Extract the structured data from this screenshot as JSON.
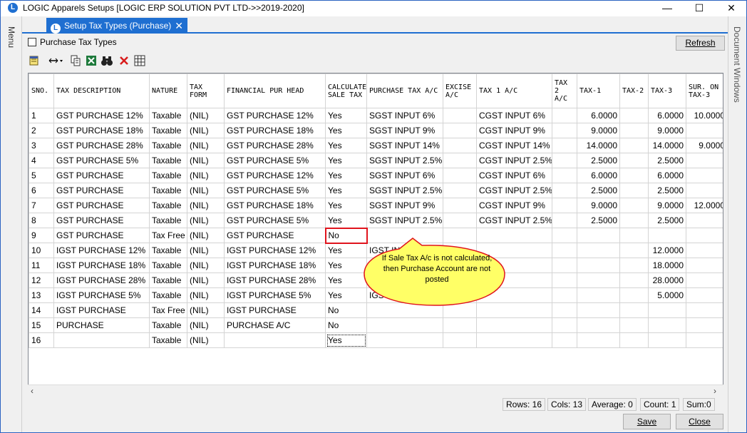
{
  "window": {
    "title": "LOGIC Apparels Setups  [LOGIC ERP SOLUTION PVT LTD->>2019-2020]",
    "minimize": "—",
    "maximize": "☐",
    "close": "✕"
  },
  "sidebars": {
    "left": "Menu",
    "right": "Document Windows"
  },
  "tab": {
    "label": "Setup Tax Types (Purchase)",
    "close": "✕"
  },
  "filter": {
    "checkbox_label": "Purchase Tax Types",
    "checked": false
  },
  "refresh_label": "Refresh",
  "toolbar": {
    "icons": [
      "notepad-icon",
      "resize-columns-icon",
      "copy-icon",
      "excel-icon",
      "binoculars-icon",
      "delete-icon",
      "grid-icon"
    ]
  },
  "columns": [
    "SNO.",
    "TAX DESCRIPTION",
    "NATURE",
    "TAX FORM",
    "FINANCIAL PUR HEAD",
    "CALCULATE SALE TAX",
    "PURCHASE TAX A/C",
    "EXCISE A/C",
    "TAX 1 A/C",
    "TAX 2 A/C",
    "TAX-1",
    "TAX-2",
    "TAX-3",
    "SUR. ON TAX-3"
  ],
  "rows": [
    {
      "sno": "1",
      "desc": "GST PURCHASE 12%",
      "nature": "Taxable",
      "form": "(NIL)",
      "head": "GST PURCHASE 12%",
      "calc": "Yes",
      "ptax": "SGST INPUT 6%",
      "excise": "",
      "tax1ac": "CGST INPUT 6%",
      "tax2ac": "",
      "tax1": "6.0000",
      "tax2": "",
      "tax3": "6.0000",
      "sur": "10.0000"
    },
    {
      "sno": "2",
      "desc": "GST PURCHASE 18%",
      "nature": "Taxable",
      "form": "(NIL)",
      "head": "GST PURCHASE 18%",
      "calc": "Yes",
      "ptax": "SGST INPUT 9%",
      "excise": "",
      "tax1ac": "CGST INPUT 9%",
      "tax2ac": "",
      "tax1": "9.0000",
      "tax2": "",
      "tax3": "9.0000",
      "sur": ""
    },
    {
      "sno": "3",
      "desc": "GST PURCHASE 28%",
      "nature": "Taxable",
      "form": "(NIL)",
      "head": "GST PURCHASE 28%",
      "calc": "Yes",
      "ptax": "SGST INPUT 14%",
      "excise": "",
      "tax1ac": "CGST INPUT 14%",
      "tax2ac": "",
      "tax1": "14.0000",
      "tax2": "",
      "tax3": "14.0000",
      "sur": "9.0000"
    },
    {
      "sno": "4",
      "desc": "GST PURCHASE 5%",
      "nature": "Taxable",
      "form": "(NIL)",
      "head": "GST PURCHASE 5%",
      "calc": "Yes",
      "ptax": "SGST INPUT 2.5%",
      "excise": "",
      "tax1ac": "CGST INPUT 2.5%",
      "tax2ac": "",
      "tax1": "2.5000",
      "tax2": "",
      "tax3": "2.5000",
      "sur": ""
    },
    {
      "sno": "5",
      "desc": "GST PURCHASE",
      "nature": "Taxable",
      "form": "(NIL)",
      "head": "GST PURCHASE 12%",
      "calc": "Yes",
      "ptax": "SGST  INPUT 6%",
      "excise": "",
      "tax1ac": "CGST INPUT 6%",
      "tax2ac": "",
      "tax1": "6.0000",
      "tax2": "",
      "tax3": "6.0000",
      "sur": ""
    },
    {
      "sno": "6",
      "desc": "GST PURCHASE",
      "nature": "Taxable",
      "form": "(NIL)",
      "head": "GST PURCHASE 5%",
      "calc": "Yes",
      "ptax": "SGST INPUT 2.5%",
      "excise": "",
      "tax1ac": "CGST INPUT 2.5%",
      "tax2ac": "",
      "tax1": "2.5000",
      "tax2": "",
      "tax3": "2.5000",
      "sur": ""
    },
    {
      "sno": "7",
      "desc": "GST PURCHASE",
      "nature": "Taxable",
      "form": "(NIL)",
      "head": "GST PURCHASE 18%",
      "calc": "Yes",
      "ptax": "SGST INPUT 9%",
      "excise": "",
      "tax1ac": "CGST INPUT 9%",
      "tax2ac": "",
      "tax1": "9.0000",
      "tax2": "",
      "tax3": "9.0000",
      "sur": "12.0000"
    },
    {
      "sno": "8",
      "desc": "GST PURCHASE",
      "nature": "Taxable",
      "form": "(NIL)",
      "head": "GST PURCHASE 5%",
      "calc": "Yes",
      "ptax": "SGST INPUT 2.5%",
      "excise": "",
      "tax1ac": "CGST INPUT 2.5%",
      "tax2ac": "",
      "tax1": "2.5000",
      "tax2": "",
      "tax3": "2.5000",
      "sur": ""
    },
    {
      "sno": "9",
      "desc": "GST PURCHASE",
      "nature": "Tax Free",
      "form": "(NIL)",
      "head": "GST PURCHASE",
      "calc": "No",
      "ptax": "",
      "excise": "",
      "tax1ac": "",
      "tax2ac": "",
      "tax1": "",
      "tax2": "",
      "tax3": "",
      "sur": ""
    },
    {
      "sno": "10",
      "desc": "IGST PURCHASE  12%",
      "nature": "Taxable",
      "form": "(NIL)",
      "head": "IGST PURCHASE 12%",
      "calc": "Yes",
      "ptax": "IGST INPU",
      "excise": "",
      "tax1ac": "",
      "tax2ac": "",
      "tax1": "",
      "tax2": "",
      "tax3": "12.0000",
      "sur": ""
    },
    {
      "sno": "11",
      "desc": "IGST PURCHASE 18%",
      "nature": "Taxable",
      "form": "(NIL)",
      "head": "IGST PURCHASE 18%",
      "calc": "Yes",
      "ptax": "",
      "excise": "",
      "tax1ac": "",
      "tax2ac": "",
      "tax1": "",
      "tax2": "",
      "tax3": "18.0000",
      "sur": ""
    },
    {
      "sno": "12",
      "desc": "IGST PURCHASE 28%",
      "nature": "Taxable",
      "form": "(NIL)",
      "head": "IGST PURCHASE 28%",
      "calc": "Yes",
      "ptax": "",
      "excise": "",
      "tax1ac": "",
      "tax2ac": "",
      "tax1": "",
      "tax2": "",
      "tax3": "28.0000",
      "sur": ""
    },
    {
      "sno": "13",
      "desc": "IGST PURCHASE 5%",
      "nature": "Taxable",
      "form": "(NIL)",
      "head": "IGST PURCHASE 5%",
      "calc": "Yes",
      "ptax": "IGS",
      "excise": "",
      "tax1ac": "",
      "tax2ac": "",
      "tax1": "",
      "tax2": "",
      "tax3": "5.0000",
      "sur": ""
    },
    {
      "sno": "14",
      "desc": "IGST PURCHASE",
      "nature": "Tax Free",
      "form": "(NIL)",
      "head": "IGST PURCHASE",
      "calc": "No",
      "ptax": "",
      "excise": "",
      "tax1ac": "",
      "tax2ac": "",
      "tax1": "",
      "tax2": "",
      "tax3": "",
      "sur": ""
    },
    {
      "sno": "15",
      "desc": "PURCHASE",
      "nature": "Taxable",
      "form": "(NIL)",
      "head": "PURCHASE A/C",
      "calc": "No",
      "ptax": "",
      "excise": "",
      "tax1ac": "",
      "tax2ac": "",
      "tax1": "",
      "tax2": "",
      "tax3": "",
      "sur": ""
    },
    {
      "sno": "16",
      "desc": "",
      "nature": "Taxable",
      "form": "(NIL)",
      "head": "",
      "calc": "Yes",
      "ptax": "",
      "excise": "",
      "tax1ac": "",
      "tax2ac": "",
      "tax1": "",
      "tax2": "",
      "tax3": "",
      "sur": ""
    }
  ],
  "annotation": {
    "text": "If  Sale  Tax  A/c  is  not calculated,  then Purchase  Account  are not  posted",
    "fill_color": "#ffff66",
    "border_color": "#e0141d"
  },
  "status": {
    "rows": "Rows: 16",
    "cols": "Cols: 13",
    "average": "Average: 0",
    "count": "Count: 1",
    "sum": "Sum:0"
  },
  "footer": {
    "save_label": "Save",
    "close_label": "Close"
  },
  "colors": {
    "accent": "#1f6fd1",
    "highlight_border": "#e0141d"
  }
}
